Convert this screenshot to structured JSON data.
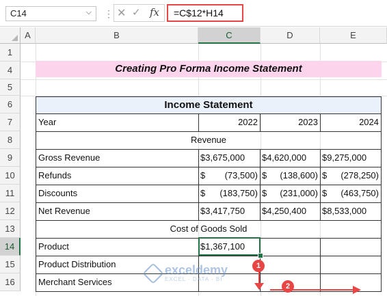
{
  "formula_bar": {
    "name_box": "C14",
    "cancel_glyph": "✕",
    "enter_glyph": "✓",
    "fx_label": "fx",
    "formula": "=C$12*H14"
  },
  "columns": [
    "A",
    "B",
    "C",
    "D",
    "E"
  ],
  "rows": [
    "1",
    "4",
    "5",
    "6",
    "7",
    "8",
    "9",
    "10",
    "11",
    "12",
    "13",
    "14",
    "15",
    "16"
  ],
  "sheet": {
    "title": "Creating Pro Forma Income Statement",
    "table_header": "Income Statement",
    "year_label": "Year",
    "years": [
      "2022",
      "2023",
      "2024"
    ],
    "revenue_section": "Revenue",
    "cogs_section": "Cost of Goods Sold",
    "currency": "$",
    "lines": [
      {
        "label": "Gross Revenue",
        "v": [
          "3,675,000",
          "4,620,000",
          "9,275,000"
        ]
      },
      {
        "label": "Refunds",
        "v": [
          "(73,500)",
          "(138,600)",
          "(278,250)"
        ]
      },
      {
        "label": "Discounts",
        "v": [
          "(183,750)",
          "(231,000)",
          "(463,750)"
        ]
      },
      {
        "label": "Net Revenue",
        "v": [
          "3,417,750",
          "4,250,400",
          "8,533,000"
        ]
      }
    ],
    "product_label": "Product",
    "product_value": "1,367,100",
    "product_distribution_label": "Product Distribution",
    "merchant_services_label": "Merchant Services"
  },
  "annotations": {
    "step1": "1",
    "step2": "2",
    "color": "#e84545"
  },
  "watermark": {
    "name": "exceldemy",
    "tagline": "EXCEL · DATA · BI"
  },
  "colors": {
    "title_fill": "#fcd5ec",
    "header_fill": "#eaf1fb",
    "selection": "#217346"
  }
}
